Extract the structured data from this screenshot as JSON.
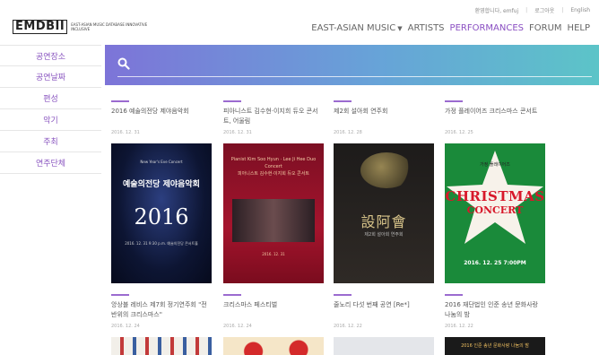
{
  "util_links": [
    "환영합니다, emfuj",
    "로그아웃",
    "English"
  ],
  "logo": {
    "mark": "EMDBII",
    "subtitle": "EAST-ASIAN MUSIC DATABASE INNOVATIVE INCLUSIVE"
  },
  "nav": [
    {
      "label": "EAST-ASIAN MUSIC",
      "dropdown": true,
      "active": false
    },
    {
      "label": "ARTISTS",
      "dropdown": false,
      "active": false
    },
    {
      "label": "PERFORMANCES",
      "dropdown": false,
      "active": true
    },
    {
      "label": "FORUM",
      "dropdown": false,
      "active": false
    },
    {
      "label": "HELP",
      "dropdown": false,
      "active": false
    }
  ],
  "sidebar": [
    "공연장소",
    "공연날짜",
    "편성",
    "악기",
    "주최",
    "연주단체"
  ],
  "search": {
    "icon": "search-icon",
    "placeholder": ""
  },
  "cards_row1": [
    {
      "title": "2016 예술의전당 제야음악회",
      "date": "2016. 12. 31"
    },
    {
      "title": "피아니스트 김수현·이지희 듀오 콘서트, 어울림",
      "date": "2016. 12. 31"
    },
    {
      "title": "제2회 설아회 연주회",
      "date": "2016. 12. 28"
    },
    {
      "title": "가정 플레이어즈 크리스마스 콘서트",
      "date": "2016. 12. 25"
    }
  ],
  "posters": {
    "p1": {
      "small": "New Year's Eve Concert",
      "kor": "예술의전당 제야음악회",
      "big": "2016",
      "foot": "2016. 12. 31 9:30 p.m. 예술의전당 콘서트홀"
    },
    "p2": {
      "header": "Pianist Kim Soo Hyun · Lee Ji Hee Duo Concert",
      "kor": "피아니스트 김수현·이지희 듀오 콘서트",
      "footer": "2016. 12. 31"
    },
    "p3": {
      "hanja": "設阿會",
      "sub": "제2회 설아회 연주회"
    },
    "p4": {
      "top": "가정 플레이어즈",
      "xmas": "CHRISTMAS",
      "concert": "CONCERT",
      "date": "2016. 12. 25 7:00PM"
    }
  },
  "cards_row2": [
    {
      "title": "앙상블 레비스 제7회 정기연주회 \"전반위의 크리스마스\"",
      "date": "2016. 12. 24"
    },
    {
      "title": "크리스마스 페스티벌",
      "date": "2016. 12. 24"
    },
    {
      "title": "줄노리 다섯 번째 공연 [Re*]",
      "date": "2016. 12. 22"
    },
    {
      "title": "2016 재단법인 인준 송년 문화사랑 나눔의 밤",
      "date": "2016. 12. 22"
    }
  ],
  "stub4_text": "2016 인준 송년 문화사랑 나눔의 밤",
  "colors": {
    "accent": "#8a4fc2",
    "search_gradient_start": "#7d74d8",
    "search_gradient_end": "#5cc4c8"
  }
}
